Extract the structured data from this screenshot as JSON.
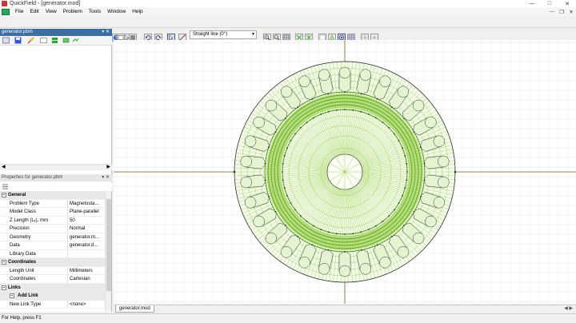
{
  "window": {
    "title": "QuickField - [generator.mod]"
  },
  "menu": [
    "File",
    "Edit",
    "View",
    "Problem",
    "Tools",
    "Window",
    "Help"
  ],
  "toolbar": {
    "draw_mode": "Straight line (0°)"
  },
  "problem_pane": {
    "title": "generator.pbm"
  },
  "properties_pane": {
    "title": "Properties for generator.pbm"
  },
  "properties": [
    {
      "type": "section",
      "label": "General"
    },
    {
      "type": "row",
      "key": "Problem Type",
      "value": "Magnetosta..."
    },
    {
      "type": "row",
      "key": "Model Class",
      "value": "Plane-parallel"
    },
    {
      "type": "row",
      "key": "Z Length (Lₓ), mm",
      "value": "50"
    },
    {
      "type": "row",
      "key": "Precision",
      "value": "Normal"
    },
    {
      "type": "row",
      "key": "Geometry",
      "value": "generator.m..."
    },
    {
      "type": "row",
      "key": "Data",
      "value": "generator.d..."
    },
    {
      "type": "row",
      "key": "Library Data",
      "value": ""
    },
    {
      "type": "section",
      "label": "Coordinates"
    },
    {
      "type": "row",
      "key": "Length Unit",
      "value": "Millimeters"
    },
    {
      "type": "row",
      "key": "Coordinates",
      "value": "Cartesian"
    },
    {
      "type": "section",
      "label": "Links"
    },
    {
      "type": "subsection",
      "label": "Add Link"
    },
    {
      "type": "row",
      "key": "New Link Type",
      "value": "<none>"
    }
  ],
  "document_tab": {
    "label": "generator.mod"
  },
  "status": {
    "text": "For Help, press F1"
  },
  "colors": {
    "mesh": "#7ec21f",
    "mesh_dense": "#3c8f0a",
    "node": "#333333",
    "axis": "#6b5d1a",
    "grid": "#e3e3e3"
  }
}
